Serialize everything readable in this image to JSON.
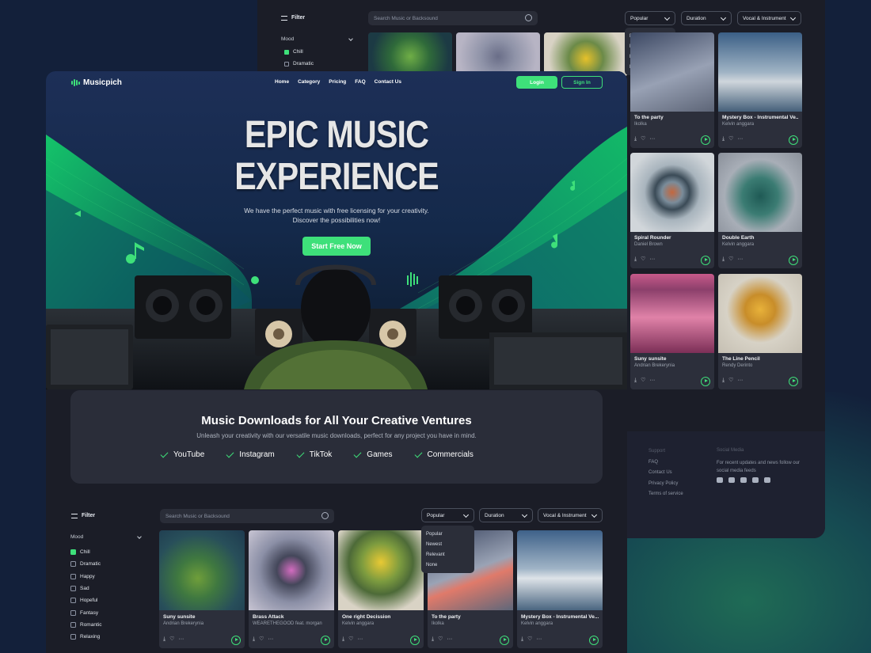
{
  "brand": {
    "name": "Musicpich",
    "accent": "#3ee07a"
  },
  "nav": {
    "links": [
      "Home",
      "Category",
      "Pricing",
      "FAQ",
      "Contact Us"
    ],
    "login": "Login",
    "signin": "Sign In"
  },
  "hero": {
    "title_line1": "EPIC MUSIC",
    "title_line2": "EXPERIENCE",
    "subtitle": "We have the perfect music with free licensing for your creativity. Discover the possibilities now!",
    "cta": "Start Free Now"
  },
  "ventures": {
    "title": "Music Downloads for All Your Creative Ventures",
    "subtitle": "Unleash your creativity with our versatile music downloads, perfect for any project you have in mind.",
    "chips": [
      "YouTube",
      "Instagram",
      "TikTok",
      "Games",
      "Commercials"
    ]
  },
  "filter": {
    "label": "Filter",
    "search_placeholder": "Search Music or Backsound",
    "sort": "Popular",
    "duration": "Duration",
    "vocal": "Vocal & Instrument",
    "sort_options": [
      "Popular",
      "Newest",
      "Relevant",
      "None"
    ],
    "mood_label": "Mood",
    "moods": [
      {
        "label": "Chill",
        "checked": true
      },
      {
        "label": "Dramatic",
        "checked": false
      },
      {
        "label": "Happy",
        "checked": false
      },
      {
        "label": "Sad",
        "checked": false
      },
      {
        "label": "Hopeful",
        "checked": false
      },
      {
        "label": "Fantasy",
        "checked": false
      },
      {
        "label": "Romantic",
        "checked": false
      },
      {
        "label": "Relaxing",
        "checked": false
      }
    ]
  },
  "tracks": [
    {
      "title": "Suny sunsite",
      "artist": "Andrian Brekerynia"
    },
    {
      "title": "Brass Attack",
      "artist": "WEARETHEGOOD feat. morgan"
    },
    {
      "title": "One right Decission",
      "artist": "Kelvin anggara"
    },
    {
      "title": "To the party",
      "artist": "Ikolka"
    },
    {
      "title": "Mystery Box - Instrumental Ve...",
      "artist": "Kelvin anggara"
    }
  ],
  "back_tracks": [
    {
      "title": "To the party",
      "artist": "Ikolka"
    },
    {
      "title": "Mystery Box - Instrumental Ve...",
      "artist": "Kelvin anggara"
    },
    {
      "title": "Spiral Rounder",
      "artist": "Daniel Brown"
    },
    {
      "title": "Double Earth",
      "artist": "Kelvin anggara"
    },
    {
      "title": "Suny sunsite",
      "artist": "Andrian Brekerynia"
    },
    {
      "title": "The Line Pencil",
      "artist": "Rendy Derinto"
    }
  ],
  "footer": {
    "support_label": "Support",
    "support_links": [
      "FAQ",
      "Contact Us",
      "Privacy Policy",
      "Terms of service"
    ],
    "social_label": "Social Media",
    "social_text": "For recent updates and news follow our social media feeds",
    "social_icons": [
      "youtube-icon",
      "instagram-icon",
      "facebook-icon",
      "twitter-icon",
      "mail-icon"
    ]
  }
}
